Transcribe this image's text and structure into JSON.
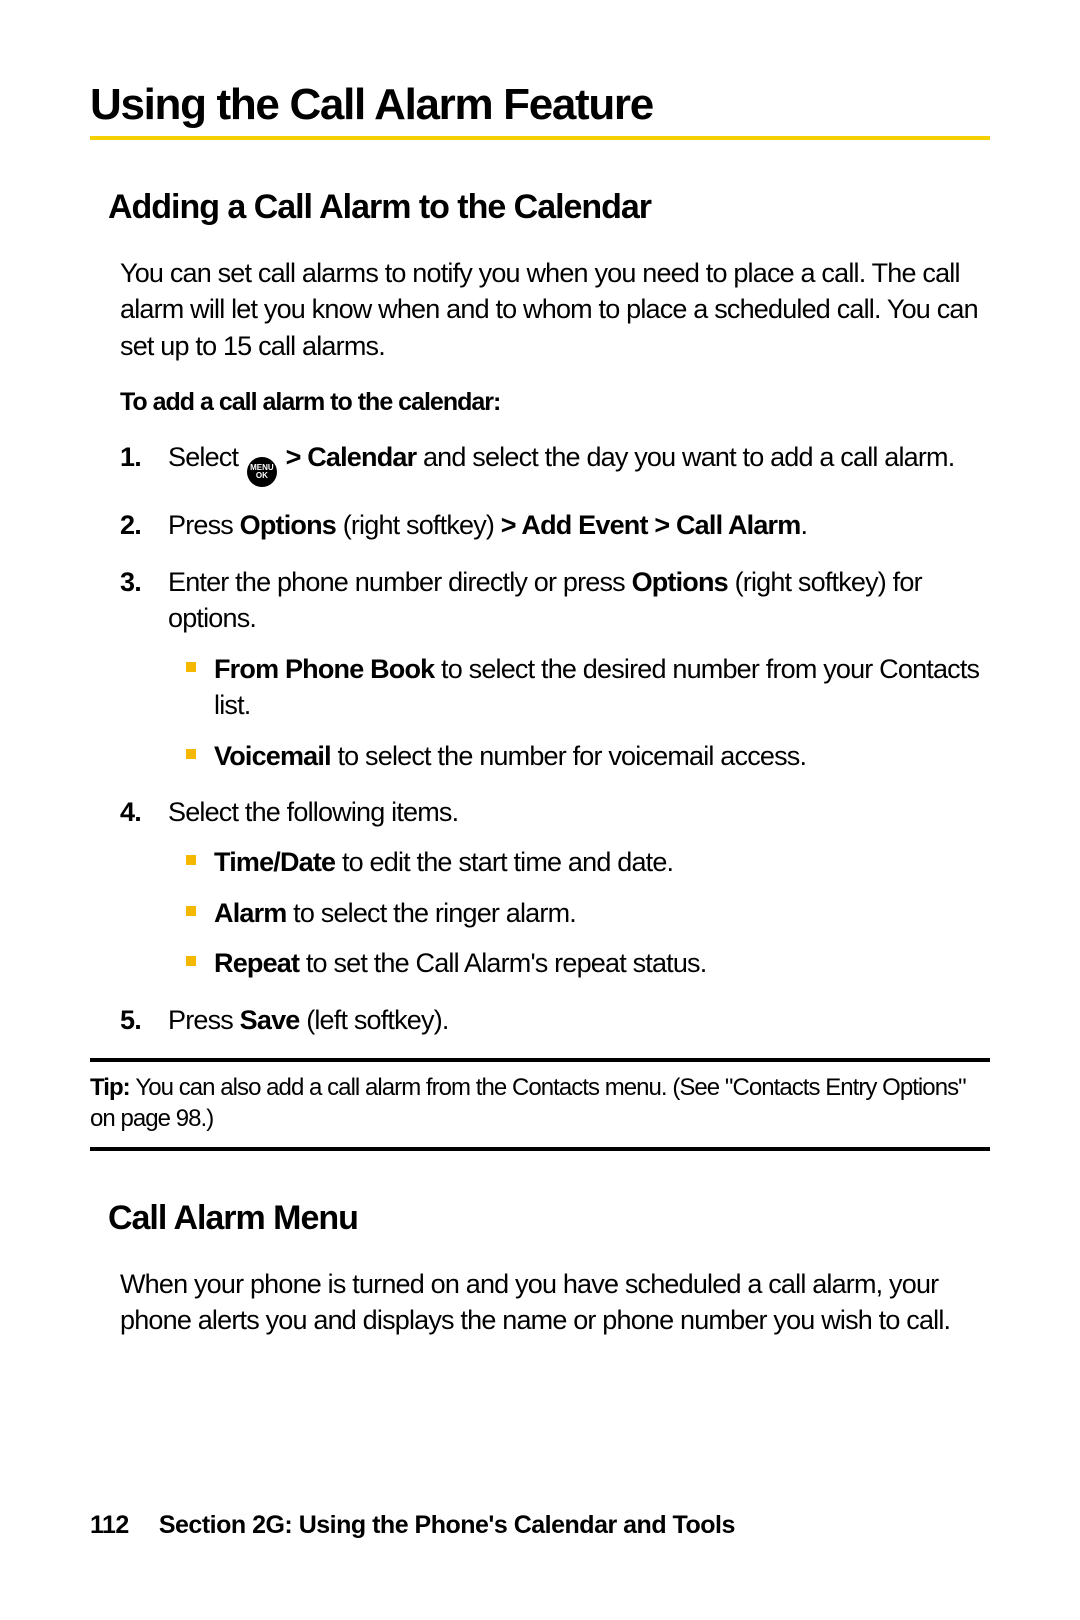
{
  "heading": "Using the Call Alarm Feature",
  "section1": {
    "title": "Adding a Call Alarm to the Calendar",
    "intro": "You can set call alarms to notify you when you need to place a call. The call alarm will let you know when and to whom to place a scheduled call. You can set up to 15 call alarms.",
    "leadIn": "To add a call alarm to the calendar:",
    "step1_a": "Select ",
    "step1_b": " > Calendar",
    "step1_c": " and select the day you want to add a call alarm.",
    "step2_a": "Press ",
    "step2_b": "Options",
    "step2_c": " (right softkey) ",
    "step2_d": "> Add Event > Call Alarm",
    "step2_e": ".",
    "step3_a": "Enter the phone number directly or press ",
    "step3_b": "Options",
    "step3_c": " (right softkey) for options.",
    "sub3_1_b": "From Phone Book",
    "sub3_1_t": " to select the desired number from your Contacts list.",
    "sub3_2_b": "Voicemail",
    "sub3_2_t": " to select the number for voicemail access.",
    "step4": "Select the following items.",
    "sub4_1_b": "Time/Date",
    "sub4_1_t": " to edit the start time and date.",
    "sub4_2_b": "Alarm",
    "sub4_2_t": " to select the ringer alarm.",
    "sub4_3_b": "Repeat",
    "sub4_3_t": " to set the Call Alarm's repeat status.",
    "step5_a": "Press ",
    "step5_b": "Save",
    "step5_c": " (left softkey)."
  },
  "tip": {
    "label": "Tip: ",
    "text": "You can also add a call alarm from the Contacts menu. (See \"Contacts Entry Options\" on page 98.)"
  },
  "section2": {
    "title": "Call Alarm Menu",
    "body": "When your phone is turned on and you have scheduled a call alarm, your phone alerts you and displays the name or phone number you wish to call."
  },
  "footer": {
    "page": "112",
    "section": "Section 2G: Using the Phone's Calendar and Tools"
  },
  "icon": {
    "line1": "MENU",
    "line2": "OK"
  },
  "nums": {
    "n1": "1.",
    "n2": "2.",
    "n3": "3.",
    "n4": "4.",
    "n5": "5."
  }
}
